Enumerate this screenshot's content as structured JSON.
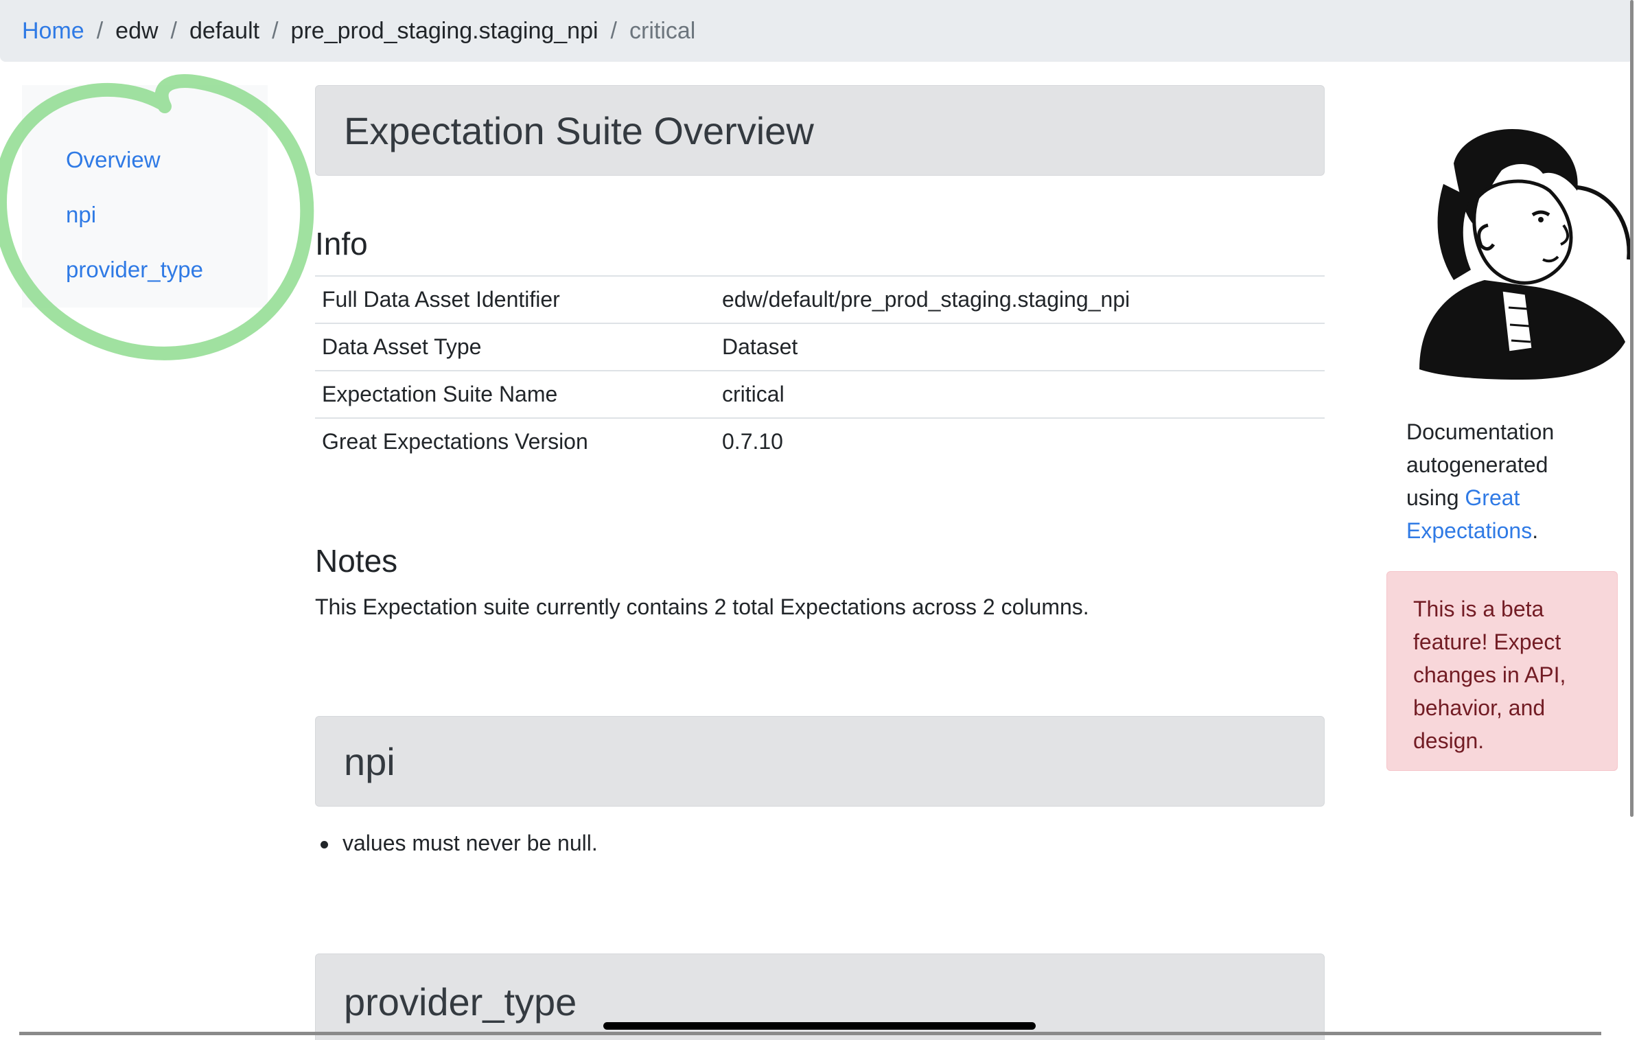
{
  "breadcrumb": {
    "items": [
      {
        "label": "Home"
      },
      {
        "label": "edw"
      },
      {
        "label": "default"
      },
      {
        "label": "pre_prod_staging.staging_npi"
      },
      {
        "label": "critical"
      }
    ],
    "separator": "/"
  },
  "sidebar": {
    "items": [
      {
        "label": "Overview"
      },
      {
        "label": "npi"
      },
      {
        "label": "provider_type"
      }
    ]
  },
  "main": {
    "title": "Expectation Suite Overview",
    "info": {
      "heading": "Info",
      "rows": [
        {
          "label": "Full Data Asset Identifier",
          "value": "edw/default/pre_prod_staging.staging_npi"
        },
        {
          "label": "Data Asset Type",
          "value": "Dataset"
        },
        {
          "label": "Expectation Suite Name",
          "value": "critical"
        },
        {
          "label": "Great Expectations Version",
          "value": "0.7.10"
        }
      ]
    },
    "notes": {
      "heading": "Notes",
      "text": "This Expectation suite currently contains 2 total Expectations across 2 columns."
    },
    "columns": [
      {
        "name": "npi",
        "expectations": [
          "values must never be null."
        ]
      },
      {
        "name": "provider_type"
      }
    ]
  },
  "right": {
    "doc_prefix": "Documentation autogenerated using ",
    "doc_link": "Great Expectations",
    "doc_suffix": ".",
    "beta_alert": "This is a beta feature! Expect changes in API, behavior, and design."
  },
  "colors": {
    "link": "#2f7ae5",
    "breadcrumb_bg": "#e9ecef",
    "card_header_bg": "#e2e3e5",
    "alert_bg": "#f8d7da",
    "alert_text": "#721c24",
    "highlight_circle": "#7fd67f"
  },
  "icons": {
    "mascot": "great-expectations-mascot-icon",
    "annotation": "green-highlight-circle"
  }
}
